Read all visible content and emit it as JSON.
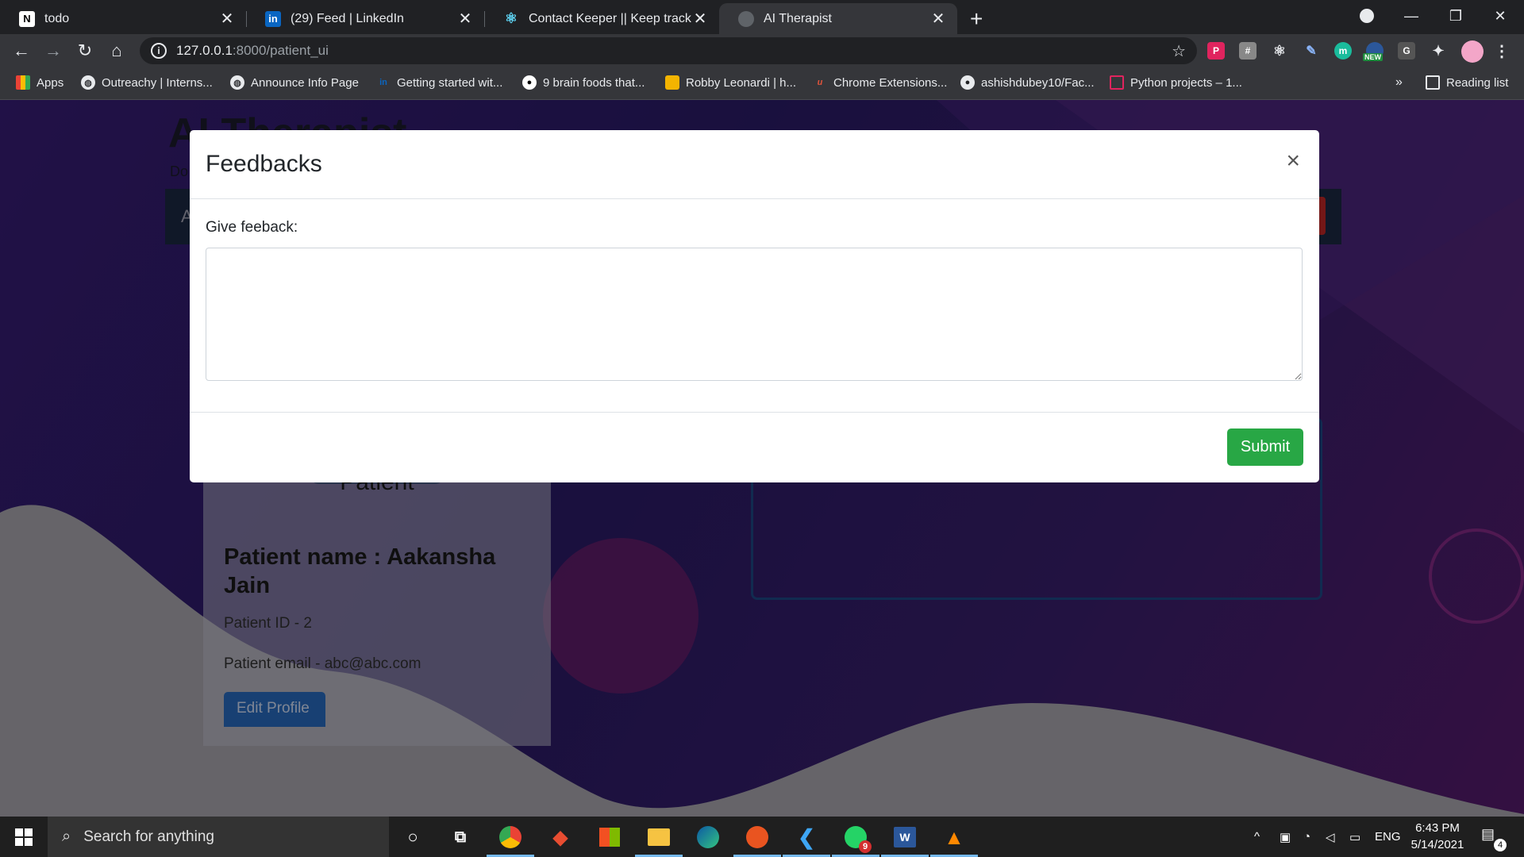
{
  "browser": {
    "tabs": [
      {
        "title": "todo",
        "icon": "notion-icon",
        "active": false
      },
      {
        "title": "(29) Feed | LinkedIn",
        "icon": "linkedin-icon",
        "active": false
      },
      {
        "title": "Contact Keeper || Keep track of y",
        "icon": "react-icon",
        "active": false
      },
      {
        "title": "AI Therapist",
        "icon": "globe-icon",
        "active": true
      }
    ],
    "address": {
      "host": "127.0.0.1",
      "path": ":8000/patient_ui"
    },
    "extension_badge": "NEW",
    "bookmarks": [
      {
        "label": "Apps"
      },
      {
        "label": "Outreachy | Interns..."
      },
      {
        "label": "Announce Info Page"
      },
      {
        "label": "Getting started wit..."
      },
      {
        "label": "9 brain foods that..."
      },
      {
        "label": "Robby Leonardi | h..."
      },
      {
        "label": "Chrome Extensions..."
      },
      {
        "label": "ashishdubey10/Fac..."
      },
      {
        "label": "Python projects – 1..."
      }
    ],
    "bookmarks_more": "»",
    "reading_list": "Reading list"
  },
  "page": {
    "app_title": "AI Therapist",
    "app_subtitle": "Do",
    "nav_initial": "A",
    "patient_role": "Patient",
    "patient_name": "Patient name : Aakansha Jain",
    "patient_id": "Patient ID - 2",
    "patient_email": "Patient email - abc@abc.com",
    "edit_profile": "Edit Profile"
  },
  "modal": {
    "title": "Feedbacks",
    "close": "×",
    "label": "Give feeback:",
    "textarea_value": "",
    "submit": "Submit"
  },
  "taskbar": {
    "search_placeholder": "Search for anything",
    "language": "ENG",
    "time": "6:43 PM",
    "date": "5/14/2021",
    "notification_count": "4",
    "whatsapp_badge": "9"
  },
  "colors": {
    "submit_green": "#28a745",
    "page_purple": "#3a1e7a",
    "edit_blue": "#2a6fc7"
  }
}
